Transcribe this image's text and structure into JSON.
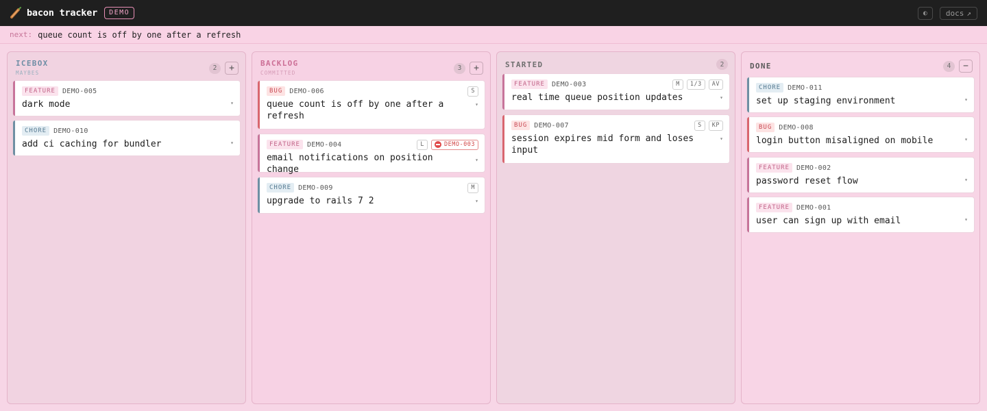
{
  "app": {
    "title": "bacon tracker",
    "badge": "DEMO"
  },
  "header": {
    "theme_icon": "◐",
    "docs_label": "docs",
    "docs_icon": "↗"
  },
  "next": {
    "label": "next:",
    "text": "queue count is off by one after a refresh"
  },
  "colors": {
    "feature": "#c7749a",
    "bug": "#d9666f",
    "chore": "#6f8fa3",
    "topbar": "#1f1f1f"
  },
  "columns": [
    {
      "title": "ICEBOX",
      "subtitle": "MAYBES",
      "count": "2",
      "action": "+",
      "cards": [
        {
          "type": "FEATURE",
          "id": "DEMO-005",
          "title": "dark mode",
          "meta": []
        },
        {
          "type": "CHORE",
          "id": "DEMO-010",
          "title": "add ci caching for bundler",
          "meta": []
        }
      ]
    },
    {
      "title": "BACKLOG",
      "subtitle": "COMMITTED",
      "count": "3",
      "action": "+",
      "cards": [
        {
          "type": "BUG",
          "id": "DEMO-006",
          "title": "queue count is off by one after a refresh",
          "meta": [
            "S"
          ]
        },
        {
          "type": "FEATURE",
          "id": "DEMO-004",
          "title": "email notifications on position change",
          "meta": [
            "L"
          ],
          "blocked_by": "DEMO-003"
        },
        {
          "type": "CHORE",
          "id": "DEMO-009",
          "title": "upgrade to rails 7 2",
          "meta": [
            "M"
          ]
        }
      ]
    },
    {
      "title": "STARTED",
      "subtitle": "",
      "count": "2",
      "action": "",
      "cards": [
        {
          "type": "FEATURE",
          "id": "DEMO-003",
          "title": "real time queue position updates",
          "meta": [
            "M",
            "1/3",
            "AV"
          ]
        },
        {
          "type": "BUG",
          "id": "DEMO-007",
          "title": "session expires mid form and loses input",
          "meta": [
            "S",
            "KP"
          ]
        }
      ]
    },
    {
      "title": "DONE",
      "subtitle": "",
      "count": "4",
      "action": "−",
      "cards": [
        {
          "type": "CHORE",
          "id": "DEMO-011",
          "title": "set up staging environment",
          "meta": []
        },
        {
          "type": "BUG",
          "id": "DEMO-008",
          "title": "login button misaligned on mobile",
          "meta": []
        },
        {
          "type": "FEATURE",
          "id": "DEMO-002",
          "title": "password reset flow",
          "meta": []
        },
        {
          "type": "FEATURE",
          "id": "DEMO-001",
          "title": "user can sign up with email",
          "meta": []
        }
      ]
    }
  ],
  "expand_icon": "▾"
}
